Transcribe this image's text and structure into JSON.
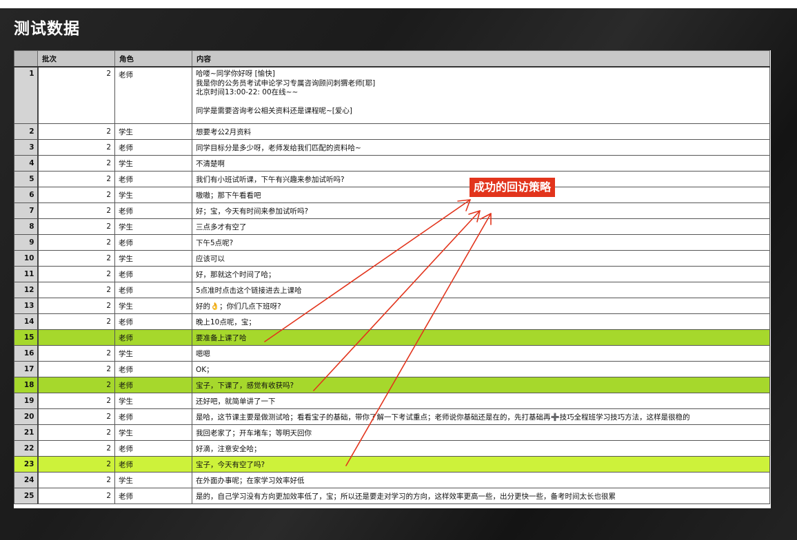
{
  "title": "测试数据",
  "columns": {
    "batch": "批次",
    "role": "角色",
    "content": "内容"
  },
  "rows": [
    {
      "idx": "1",
      "batch": "2",
      "role": "老师",
      "content": "哈喽~同学你好呀 [愉快]\n我是你的公务员考试申论学习专属咨询顾问刺猬老师[耶]\n北京时间13:00-22: 00在线~~\n\n同学是需要咨询考公相关资料还是课程呢~[爱心]"
    },
    {
      "idx": "2",
      "batch": "2",
      "role": "学生",
      "content": "想要考公2月资料"
    },
    {
      "idx": "3",
      "batch": "2",
      "role": "老师",
      "content": "同学目标分是多少呀，老师发给我们匹配的资料哈~"
    },
    {
      "idx": "4",
      "batch": "2",
      "role": "学生",
      "content": "不清楚啊"
    },
    {
      "idx": "5",
      "batch": "2",
      "role": "老师",
      "content": "我们有小班试听课，下午有兴趣来参加试听吗?"
    },
    {
      "idx": "6",
      "batch": "2",
      "role": "学生",
      "content": "嗷嗷；那下午看看吧"
    },
    {
      "idx": "7",
      "batch": "2",
      "role": "老师",
      "content": "好；宝，今天有时间来参加试听吗?"
    },
    {
      "idx": "8",
      "batch": "2",
      "role": "学生",
      "content": "三点多才有空了"
    },
    {
      "idx": "9",
      "batch": "2",
      "role": "老师",
      "content": "下午5点呢?"
    },
    {
      "idx": "10",
      "batch": "2",
      "role": "学生",
      "content": "应该可以"
    },
    {
      "idx": "11",
      "batch": "2",
      "role": "老师",
      "content": "好，那就这个时间了哈；"
    },
    {
      "idx": "12",
      "batch": "2",
      "role": "老师",
      "content": "5点准时点击这个链接进去上课哈"
    },
    {
      "idx": "13",
      "batch": "2",
      "role": "学生",
      "content": "好的👌；你们几点下班呀?"
    },
    {
      "idx": "14",
      "batch": "2",
      "role": "老师",
      "content": "晚上10点呢，宝；"
    },
    {
      "idx": "15",
      "batch": "",
      "role": "老师",
      "content": "要准备上课了哈"
    },
    {
      "idx": "16",
      "batch": "2",
      "role": "学生",
      "content": "嗯嗯"
    },
    {
      "idx": "17",
      "batch": "2",
      "role": "老师",
      "content": "OK；"
    },
    {
      "idx": "18",
      "batch": "2",
      "role": "老师",
      "content": "宝子，下课了，感觉有收获吗?"
    },
    {
      "idx": "19",
      "batch": "2",
      "role": "学生",
      "content": "还好吧，就简单讲了一下"
    },
    {
      "idx": "20",
      "batch": "2",
      "role": "老师",
      "content": "是哈，这节课主要是做测试哈；看看宝子的基础，带你了解一下考试重点；老师说你基础还是在的，先打基础再➕技巧全程班学习技巧方法，这样是很稳的"
    },
    {
      "idx": "21",
      "batch": "2",
      "role": "学生",
      "content": "我回老家了；开车堵车；等明天回你"
    },
    {
      "idx": "22",
      "batch": "2",
      "role": "老师",
      "content": "好滴，注意安全哈；"
    },
    {
      "idx": "23",
      "batch": "2",
      "role": "老师",
      "content": "宝子，今天有空了吗?"
    },
    {
      "idx": "24",
      "batch": "2",
      "role": "学生",
      "content": "在外面办事呢；在家学习效率好低"
    },
    {
      "idx": "25",
      "batch": "2",
      "role": "老师",
      "content": "是的，自己学习没有方向更加效率低了，宝；所以还是要走对学习的方向，这样效率更高一些，出分更快一些，备考时间太长也很累"
    }
  ],
  "callout": {
    "text": "成功的回访策略"
  },
  "colors": {
    "highlight_green": "#a6d82c",
    "highlight_lime": "#cdf23a",
    "callout_red": "#e2341c",
    "arrow_red": "#e2341c"
  }
}
